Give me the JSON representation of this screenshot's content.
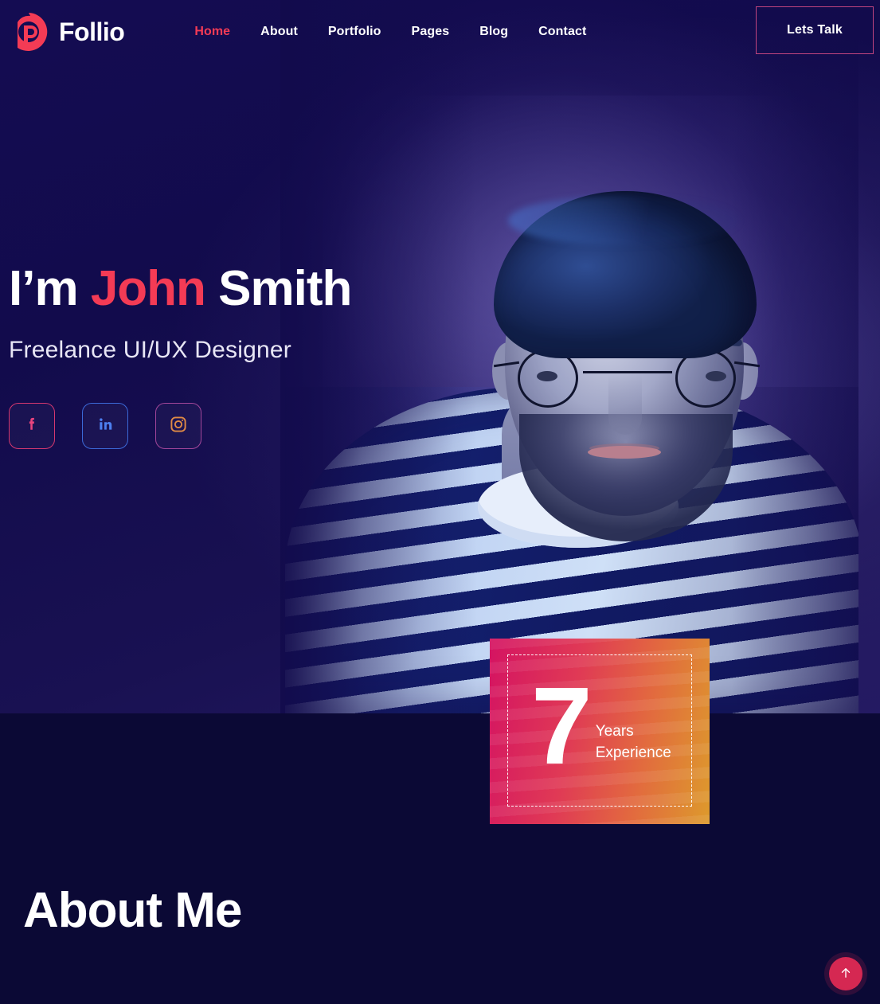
{
  "brand": {
    "name": "Follio",
    "logo_icon": "p-circle-logo-icon",
    "accent": "#f43b55"
  },
  "nav": {
    "items": [
      {
        "label": "Home",
        "active": true
      },
      {
        "label": "About",
        "active": false
      },
      {
        "label": "Portfolio",
        "active": false
      },
      {
        "label": "Pages",
        "active": false
      },
      {
        "label": "Blog",
        "active": false
      },
      {
        "label": "Contact",
        "active": false
      }
    ]
  },
  "header": {
    "cta_label": "Lets Talk",
    "cta_border_color": "#c0447e"
  },
  "hero": {
    "title_prefix": "I’m ",
    "title_accent": "John",
    "title_suffix": " Smith",
    "subtitle": "Freelance UI/UX Designer",
    "socials": [
      {
        "name": "facebook",
        "glyph": "f",
        "color": "#e8447e",
        "border": "#d4376f"
      },
      {
        "name": "linkedin",
        "glyph": "in",
        "color": "#4d7ff0",
        "border": "#3b69d8"
      },
      {
        "name": "instagram",
        "glyph": "instagram-icon",
        "color": "#e08a45",
        "border": "#a2469a"
      }
    ],
    "portrait_alt": "Portrait of bearded man wearing round glasses and a navy-and-white striped shirt"
  },
  "experience_badge": {
    "number": "7",
    "line1": "Years",
    "line2": "Experience",
    "gradient_start": "#d41362",
    "gradient_end": "#dd9a2c"
  },
  "about": {
    "title": "About Me"
  },
  "scroll_top": {
    "name": "scroll-to-top",
    "icon": "arrow-up-icon",
    "color": "#d52852"
  },
  "theme": {
    "background": "#0b0935",
    "hero_background": "#140c52",
    "accent_red": "#f43b55",
    "text": "#ffffff"
  }
}
